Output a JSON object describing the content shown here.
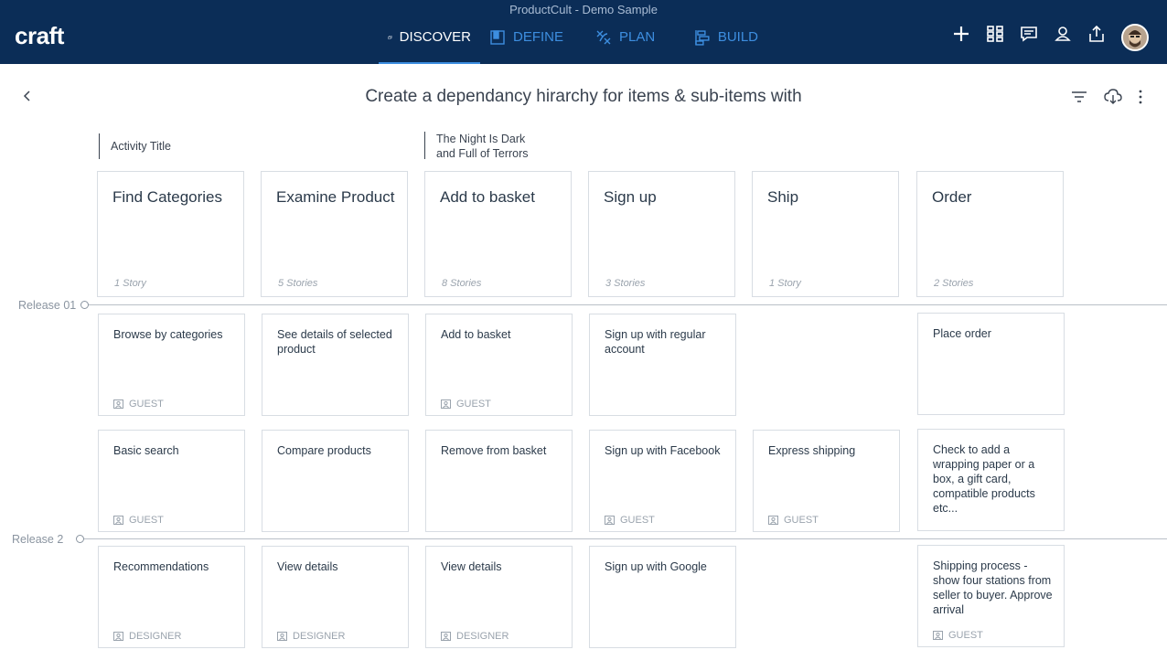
{
  "app": {
    "title": "ProductCult - Demo Sample",
    "logo": "craft"
  },
  "tabs": [
    {
      "label": "DISCOVER",
      "icon": "discover-icon",
      "active": true
    },
    {
      "label": "DEFINE",
      "icon": "define-icon",
      "active": false
    },
    {
      "label": "PLAN",
      "icon": "plan-icon",
      "active": false
    },
    {
      "label": "BUILD",
      "icon": "build-icon",
      "active": false
    }
  ],
  "header_icons": [
    "plus-icon",
    "grid-icon",
    "comment-icon",
    "users-icon",
    "share-icon"
  ],
  "page": {
    "title": "Create a dependancy hirarchy for items & sub-items with",
    "labels": {
      "activity_title": "Activity Title",
      "night_line1": "The Night Is Dark",
      "night_line2": "and Full of Terrors"
    }
  },
  "activities": [
    {
      "title": "Find Categories",
      "count": "1 Story"
    },
    {
      "title": "Examine Product",
      "count": "5 Stories"
    },
    {
      "title": "Add to basket",
      "count": "8 Stories"
    },
    {
      "title": "Sign up",
      "count": "3 Stories"
    },
    {
      "title": "Ship",
      "count": "1 Story"
    },
    {
      "title": "Order",
      "count": "2 Stories"
    }
  ],
  "releases": [
    {
      "label": "Release 01"
    },
    {
      "label": "Release 2"
    }
  ],
  "stories": {
    "row1": [
      {
        "title": "Browse by categories",
        "persona": "GUEST"
      },
      {
        "title": "See details of selected product",
        "persona": ""
      },
      {
        "title": "Add to basket",
        "persona": "GUEST"
      },
      {
        "title": "Sign up with regular account",
        "persona": ""
      },
      {
        "title": "Place order",
        "persona": ""
      }
    ],
    "row2": [
      {
        "title": "Basic search",
        "persona": "GUEST"
      },
      {
        "title": "Compare products",
        "persona": ""
      },
      {
        "title": "Remove from basket",
        "persona": ""
      },
      {
        "title": "Sign up with Facebook",
        "persona": "GUEST"
      },
      {
        "title": "Express shipping",
        "persona": "GUEST"
      },
      {
        "title": "Check to add a wrapping paper or a box, a gift card, compatible products etc...",
        "persona": ""
      }
    ],
    "row3": [
      {
        "title": "Recommendations",
        "persona": "DESIGNER"
      },
      {
        "title": "View details",
        "persona": "DESIGNER"
      },
      {
        "title": "View details",
        "persona": "DESIGNER"
      },
      {
        "title": "Sign up with Google",
        "persona": ""
      },
      {
        "title": "Shipping process - show four stations from seller to buyer. Approve arrival",
        "persona": "GUEST"
      }
    ]
  },
  "colors": {
    "topbar": "#0b2d57",
    "accent": "#3d8ee0",
    "border": "#d8dde3"
  }
}
